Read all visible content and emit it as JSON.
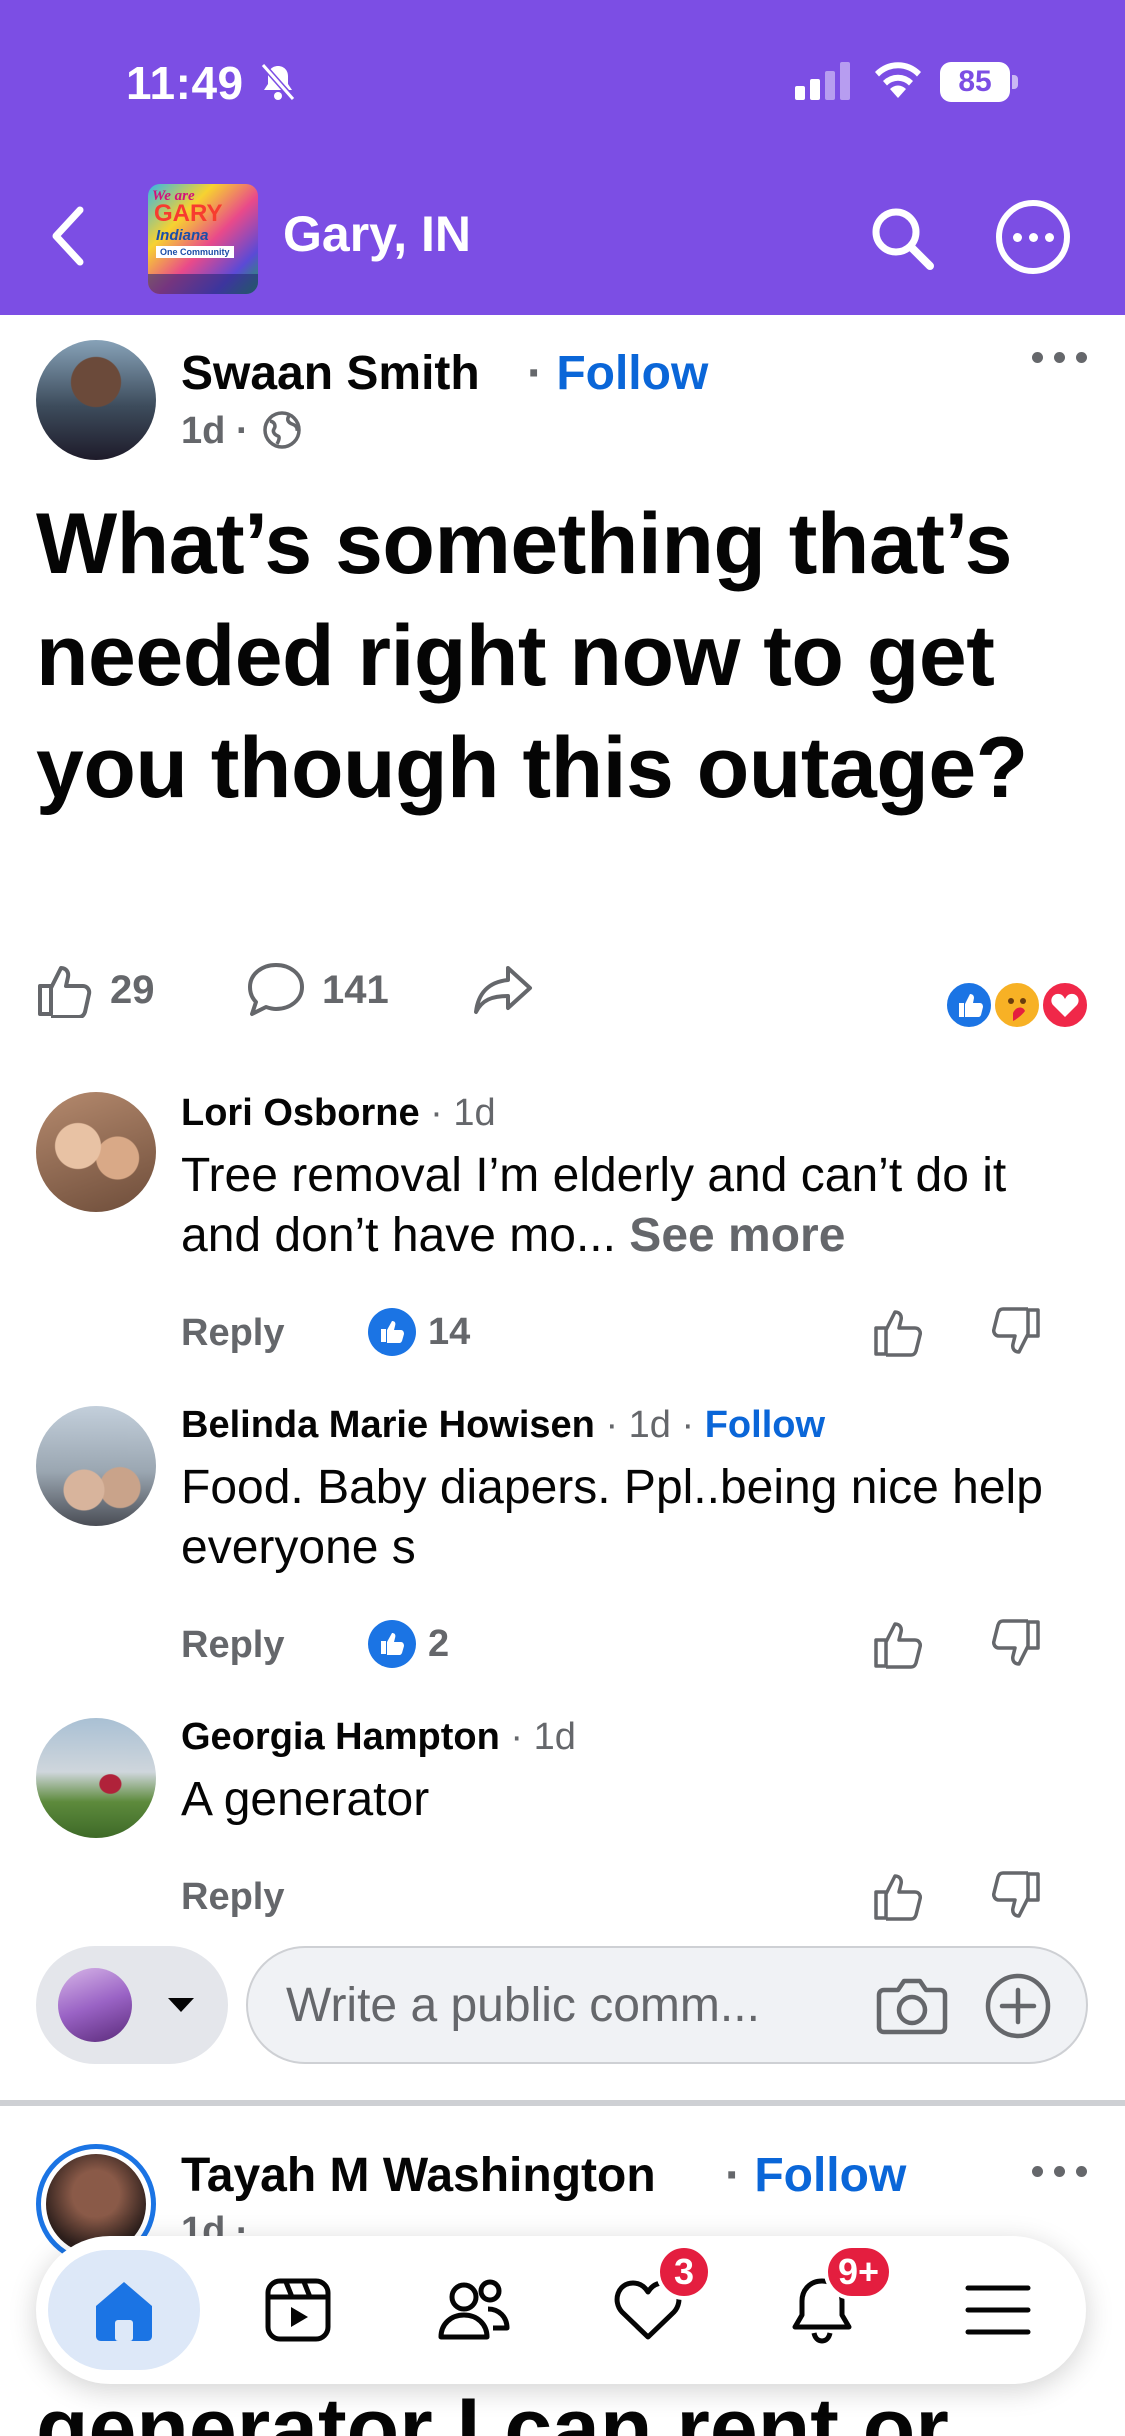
{
  "status_bar": {
    "time": "11:49",
    "battery": "85"
  },
  "header": {
    "group_name": "Gary, IN",
    "group_avatar_text": [
      "We are",
      "GARY",
      "Indiana",
      "One Community"
    ]
  },
  "post": {
    "author": "Swaan Smith",
    "separator": "·",
    "follow_label": "Follow",
    "time": "1d",
    "text": "What’s something that’s needed right now to get you though this outage?",
    "like_count": "29",
    "comment_count": "141"
  },
  "comments": [
    {
      "name": "Lori Osborne",
      "time": "· 1d",
      "text": "Tree removal I’m elderly and can’t do it and don’t have mo...",
      "see_more": "See more",
      "reply": "Reply",
      "likes": "14"
    },
    {
      "name": "Belinda Marie Howisen",
      "time": "· 1d ·",
      "follow_label": "Follow",
      "text": "Food.  Baby diapers. Ppl..being nice help everyone s",
      "reply": "Reply",
      "likes": "2"
    },
    {
      "name": "Georgia Hampton",
      "time": "· 1d",
      "text": "A generator",
      "reply": "Reply"
    }
  ],
  "composer": {
    "placeholder": "Write a public comm..."
  },
  "next_post": {
    "author": "Tayah M Washington",
    "separator": "·",
    "follow_label": "Follow",
    "time": "1d ·",
    "snippet": "generator I can rent or"
  },
  "tabbar": {
    "badges": {
      "dating": "3",
      "notifications": "9+"
    }
  },
  "colors": {
    "header_purple": "#7c4ee4",
    "link_blue": "#0a66d8",
    "like_blue": "#1b74e4",
    "badge_red": "#e41e3f"
  }
}
